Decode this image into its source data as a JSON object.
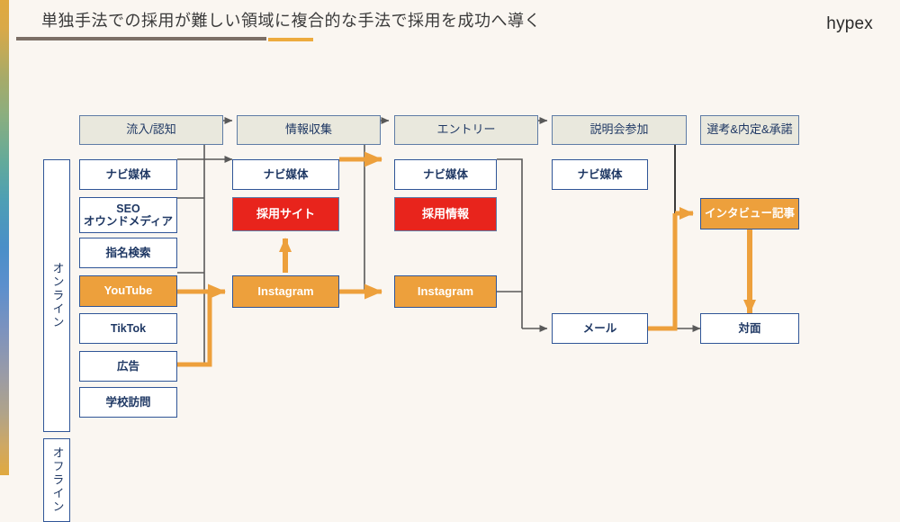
{
  "header": {
    "title": "単独手法での採用が難しい領域に複合的な手法で採用を成功へ導く",
    "brand": "hypex",
    "rule_dark_color": "#7c6f66",
    "rule_accent_color": "#edab3e"
  },
  "palette": {
    "background": "#faf6f1",
    "accent_orange": "#eda03c",
    "highlight_red": "#e8241c",
    "navy": "#1f3864",
    "border_blue": "#2f5597",
    "stage_fill": "#e9e8dd",
    "wire_gray": "#595959"
  },
  "stages": [
    {
      "label": "流入/認知"
    },
    {
      "label": "情報収集"
    },
    {
      "label": "エントリー"
    },
    {
      "label": "説明会参加"
    },
    {
      "label": "選考&内定&承諾"
    }
  ],
  "lanes": [
    {
      "label": "オンライン"
    },
    {
      "label": "オフライン"
    }
  ],
  "columns": {
    "inflow": [
      {
        "label": "ナビ媒体",
        "style": "white"
      },
      {
        "label": "SEO\nオウンドメディア",
        "style": "white"
      },
      {
        "label": "指名検索",
        "style": "white"
      },
      {
        "label": "YouTube",
        "style": "orange"
      },
      {
        "label": "TikTok",
        "style": "white"
      },
      {
        "label": "広告",
        "style": "white"
      },
      {
        "label": "学校訪問",
        "style": "white"
      }
    ],
    "research": [
      {
        "label": "ナビ媒体",
        "style": "white"
      },
      {
        "label": "採用サイト",
        "style": "red"
      },
      {
        "label": "Instagram",
        "style": "orange"
      }
    ],
    "entry": [
      {
        "label": "ナビ媒体",
        "style": "white"
      },
      {
        "label": "採用情報",
        "style": "red"
      },
      {
        "label": "Instagram",
        "style": "orange"
      }
    ],
    "briefing": [
      {
        "label": "ナビ媒体",
        "style": "white"
      },
      {
        "label": "メール",
        "style": "white"
      }
    ],
    "selection": [
      {
        "label": "インタビュー記事",
        "style": "orange-navy"
      },
      {
        "label": "対面",
        "style": "white"
      }
    ]
  }
}
